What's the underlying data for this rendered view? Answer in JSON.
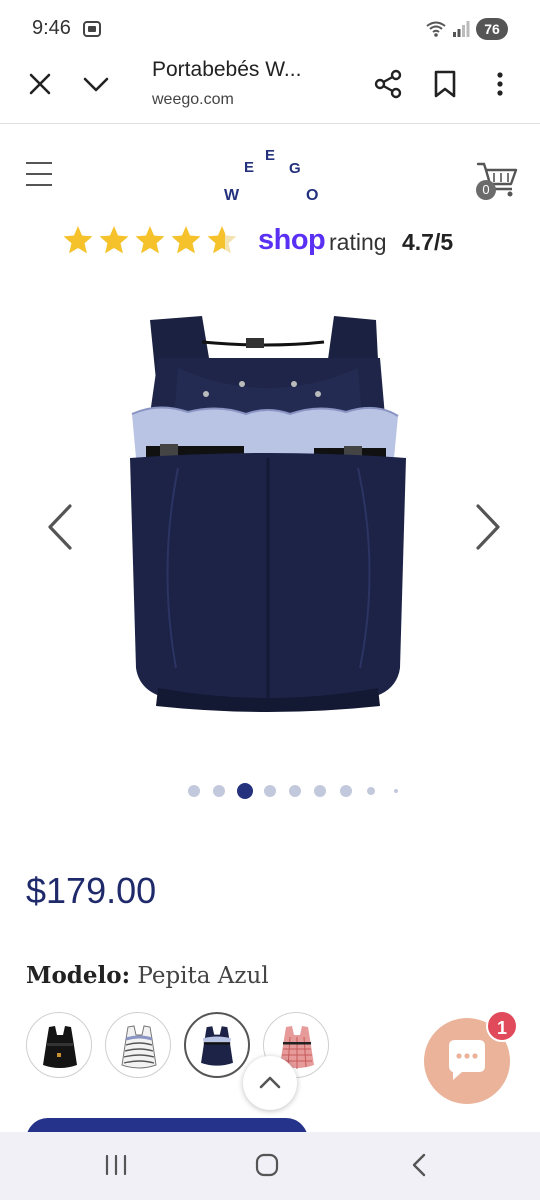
{
  "status_bar": {
    "time": "9:46",
    "battery": "76"
  },
  "browser": {
    "title": "Portabebés W...",
    "url": "weego.com"
  },
  "header": {
    "logo_letters": [
      "W",
      "E",
      "E",
      "G",
      "O"
    ],
    "cart_count": "0"
  },
  "rating": {
    "stars_value": 4.7,
    "stars_max": 5,
    "brand": "shop",
    "label": "rating",
    "value": "4.7/5"
  },
  "gallery": {
    "image_count": 9,
    "active_index": 2
  },
  "product": {
    "price": "$179.00",
    "model_label": "Modelo:",
    "model_value": "Pepita Azul"
  },
  "swatches": [
    {
      "name": "black",
      "selected": false
    },
    {
      "name": "zebra",
      "selected": false
    },
    {
      "name": "pepita-azul",
      "selected": true
    },
    {
      "name": "red-pattern",
      "selected": false
    }
  ],
  "chat": {
    "badge": "1"
  },
  "colors": {
    "navy": "#1f2a6b",
    "shop_purple": "#5a31f4",
    "star_gold": "#f5c22b",
    "chat_peach": "#eab39a",
    "badge_red": "#e04a5a",
    "button_navy": "#25338a"
  }
}
